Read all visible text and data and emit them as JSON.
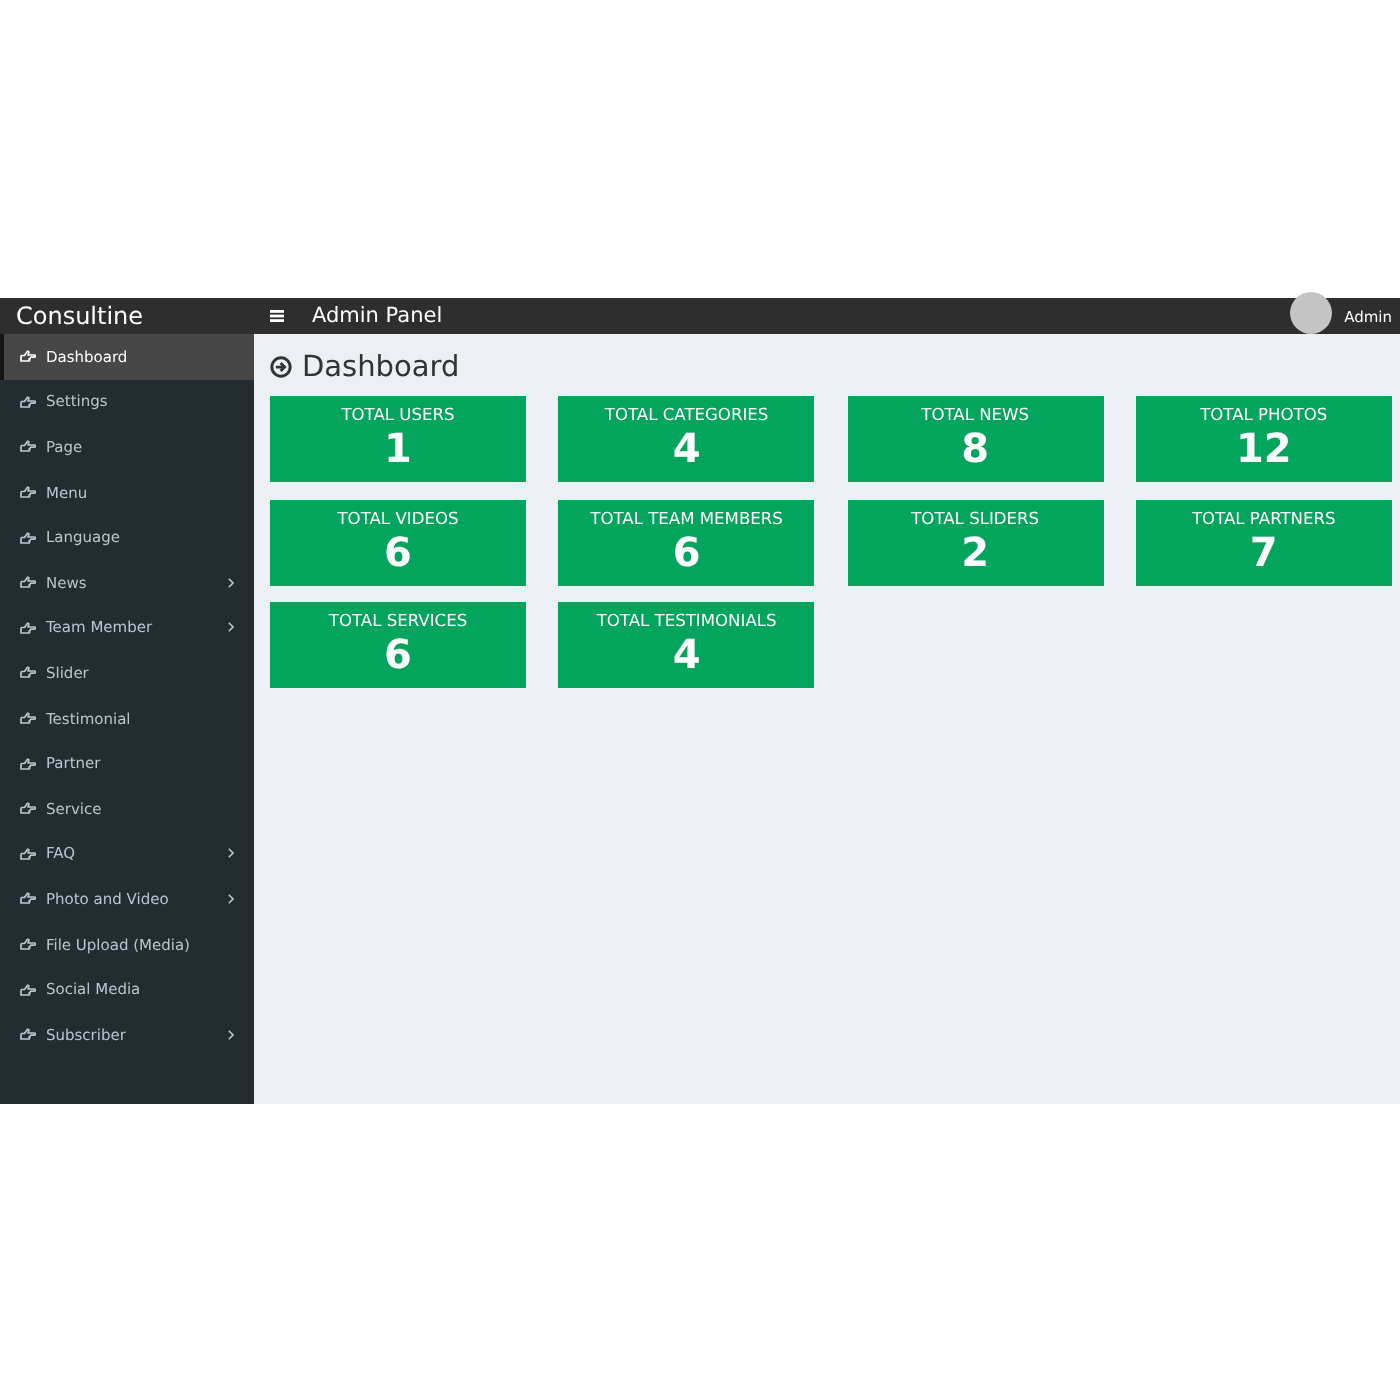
{
  "header": {
    "brand": "Consultine",
    "title": "Admin Panel",
    "user": {
      "name": "Admin"
    }
  },
  "sidebar": {
    "items": [
      {
        "label": "Dashboard",
        "selected": true,
        "has_submenu": false
      },
      {
        "label": "Settings",
        "selected": false,
        "has_submenu": false
      },
      {
        "label": "Page",
        "selected": false,
        "has_submenu": false
      },
      {
        "label": "Menu",
        "selected": false,
        "has_submenu": false
      },
      {
        "label": "Language",
        "selected": false,
        "has_submenu": false
      },
      {
        "label": "News",
        "selected": false,
        "has_submenu": true
      },
      {
        "label": "Team Member",
        "selected": false,
        "has_submenu": true
      },
      {
        "label": "Slider",
        "selected": false,
        "has_submenu": false
      },
      {
        "label": "Testimonial",
        "selected": false,
        "has_submenu": false
      },
      {
        "label": "Partner",
        "selected": false,
        "has_submenu": false
      },
      {
        "label": "Service",
        "selected": false,
        "has_submenu": false
      },
      {
        "label": "FAQ",
        "selected": false,
        "has_submenu": true
      },
      {
        "label": "Photo and Video",
        "selected": false,
        "has_submenu": true
      },
      {
        "label": "File Upload (Media)",
        "selected": false,
        "has_submenu": false
      },
      {
        "label": "Social Media",
        "selected": false,
        "has_submenu": false
      },
      {
        "label": "Subscriber",
        "selected": false,
        "has_submenu": true
      }
    ]
  },
  "page": {
    "title": "Dashboard"
  },
  "stats": [
    {
      "label": "TOTAL USERS",
      "value": "1"
    },
    {
      "label": "TOTAL CATEGORIES",
      "value": "4"
    },
    {
      "label": "TOTAL NEWS",
      "value": "8"
    },
    {
      "label": "TOTAL PHOTOS",
      "value": "12"
    },
    {
      "label": "TOTAL VIDEOS",
      "value": "6"
    },
    {
      "label": "TOTAL TEAM MEMBERS",
      "value": "6"
    },
    {
      "label": "TOTAL SLIDERS",
      "value": "2"
    },
    {
      "label": "TOTAL PARTNERS",
      "value": "7"
    },
    {
      "label": "TOTAL SERVICES",
      "value": "6"
    },
    {
      "label": "TOTAL TESTIMONIALS",
      "value": "4"
    }
  ]
}
